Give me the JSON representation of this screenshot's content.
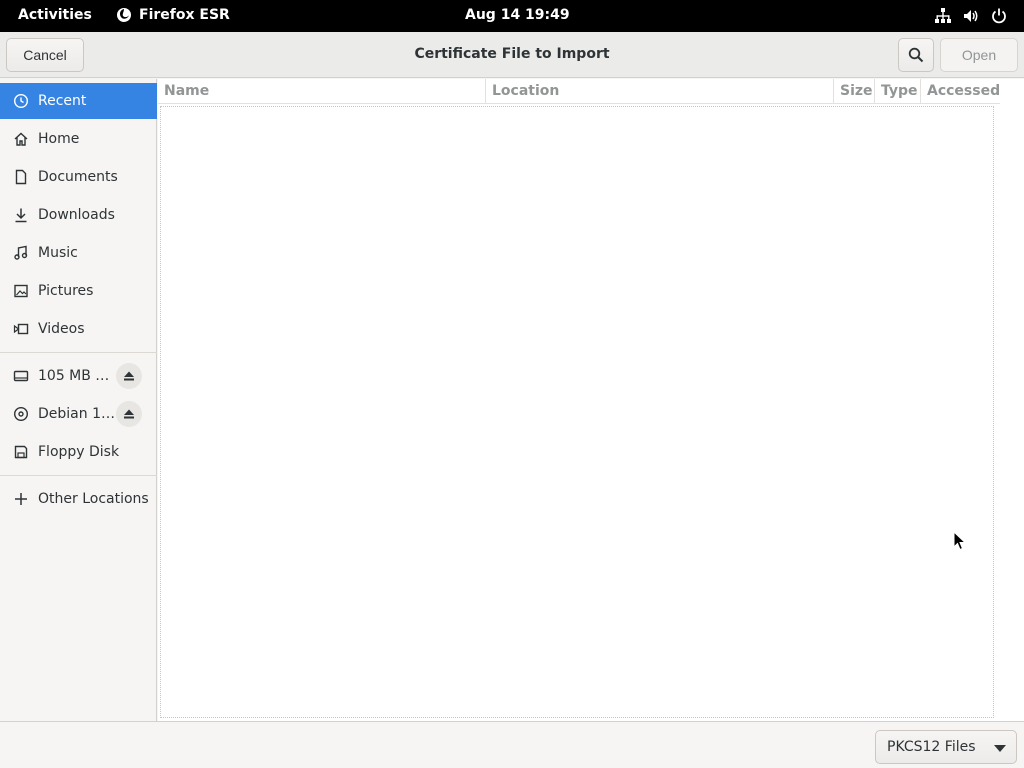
{
  "topbar": {
    "activities": "Activities",
    "app_name": "Firefox ESR",
    "clock": "Aug 14  19:49",
    "icons": [
      "network-icon",
      "volume-icon",
      "power-icon"
    ]
  },
  "dialog": {
    "title": "Certificate File to Import",
    "cancel_label": "Cancel",
    "open_label": "Open",
    "search_icon": "search-icon"
  },
  "sidebar": {
    "places": [
      {
        "label": "Recent",
        "icon": "clock-icon",
        "active": true
      },
      {
        "label": "Home",
        "icon": "home-icon"
      },
      {
        "label": "Documents",
        "icon": "document-icon"
      },
      {
        "label": "Downloads",
        "icon": "download-icon"
      },
      {
        "label": "Music",
        "icon": "music-icon"
      },
      {
        "label": "Pictures",
        "icon": "picture-icon"
      },
      {
        "label": "Videos",
        "icon": "video-icon"
      }
    ],
    "devices": [
      {
        "label": "105 MB …",
        "icon": "drive-icon",
        "ejectable": true
      },
      {
        "label": "Debian 1…",
        "icon": "optical-disc-icon",
        "ejectable": true
      },
      {
        "label": "Floppy Disk",
        "icon": "floppy-icon"
      }
    ],
    "other": {
      "label": "Other Locations",
      "icon": "plus-icon"
    }
  },
  "filelist": {
    "columns": [
      "Name",
      "Location",
      "Size",
      "Type",
      "Accessed"
    ],
    "rows": []
  },
  "footer": {
    "filter_selected": "PKCS12 Files"
  },
  "colors": {
    "accent": "#3584e4",
    "topbar_bg": "#000000",
    "window_bg": "#f6f5f4"
  }
}
